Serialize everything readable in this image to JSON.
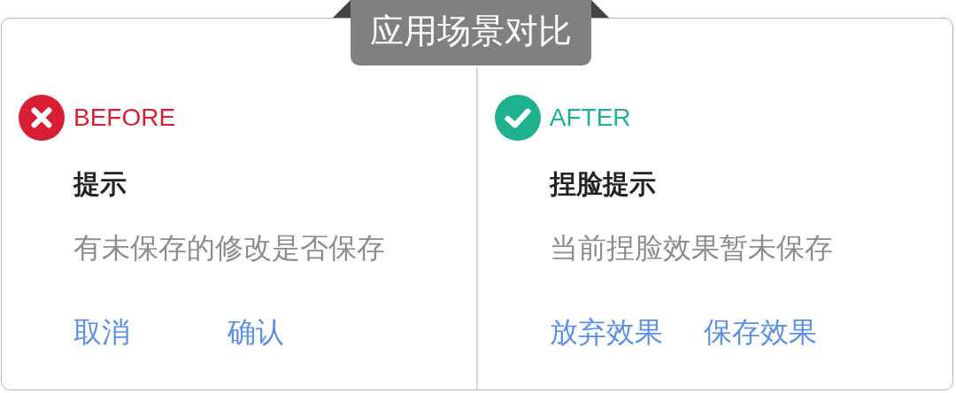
{
  "banner": {
    "title": "应用场景对比"
  },
  "panels": [
    {
      "kind": "before",
      "label": "BEFORE",
      "dialog": {
        "title": "提示",
        "message": "有未保存的修改是否保存",
        "buttons": [
          "取消",
          "确认"
        ]
      }
    },
    {
      "kind": "after",
      "label": "AFTER",
      "dialog": {
        "title": "捏脸提示",
        "message": "当前捏脸效果暂未保存",
        "buttons": [
          "放弃效果",
          "保存效果"
        ]
      }
    }
  ]
}
